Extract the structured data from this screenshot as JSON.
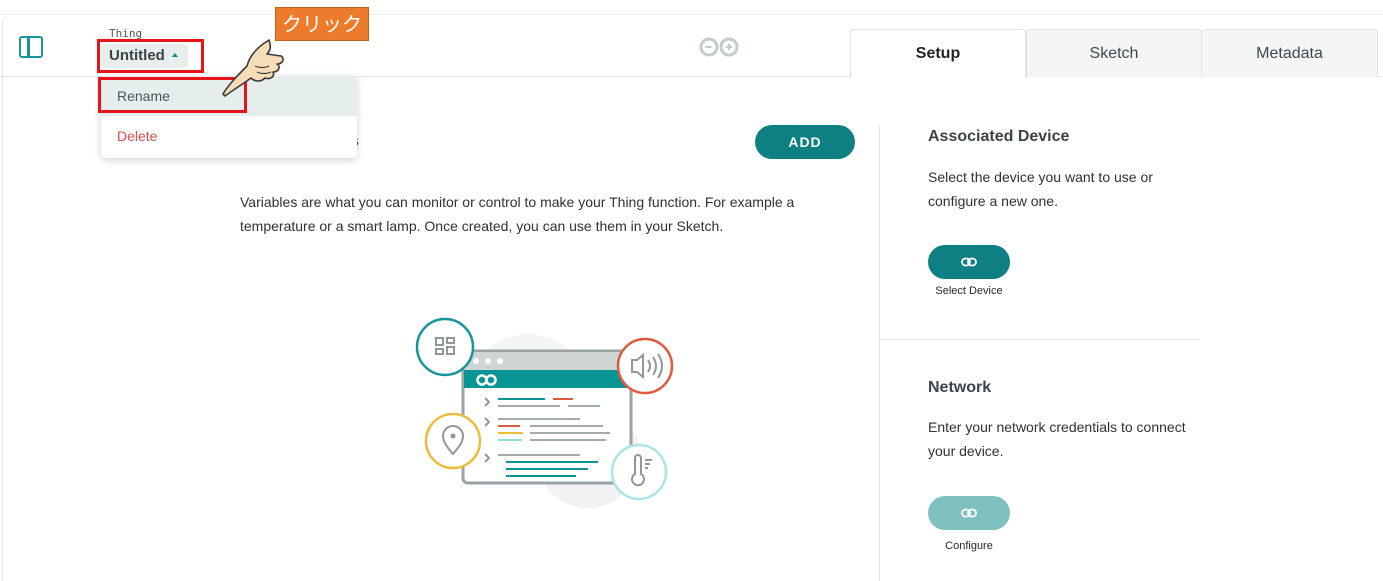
{
  "header": {
    "thing_label": "Thing",
    "thing_name": "Untitled",
    "tabs": [
      {
        "label": "Setup",
        "active": true
      },
      {
        "label": "Sketch",
        "active": false
      },
      {
        "label": "Metadata",
        "active": false
      }
    ]
  },
  "thing_menu": {
    "items": [
      {
        "label": "Rename"
      },
      {
        "label": "Delete"
      }
    ]
  },
  "annotation": {
    "callout_text": "クリック"
  },
  "variables": {
    "title_visible_fragment": "s",
    "add_label": "ADD",
    "description": "Variables are what you can monitor or control to make your Thing function. For example a temperature or a smart lamp. Once created, you can use them in your Sketch."
  },
  "associated_device": {
    "title": "Associated Device",
    "description": "Select the device you want to use or configure a new one.",
    "button_label": "Select Device"
  },
  "network": {
    "title": "Network",
    "description": "Enter your network credentials to connect your device.",
    "button_label": "Configure"
  },
  "colors": {
    "brand_teal": "#0e7f83",
    "teal_disabled": "#7fc0c1",
    "delete_red": "#d5504f",
    "highlight_red": "#e8141a",
    "callout_orange": "#ec7b2c"
  }
}
